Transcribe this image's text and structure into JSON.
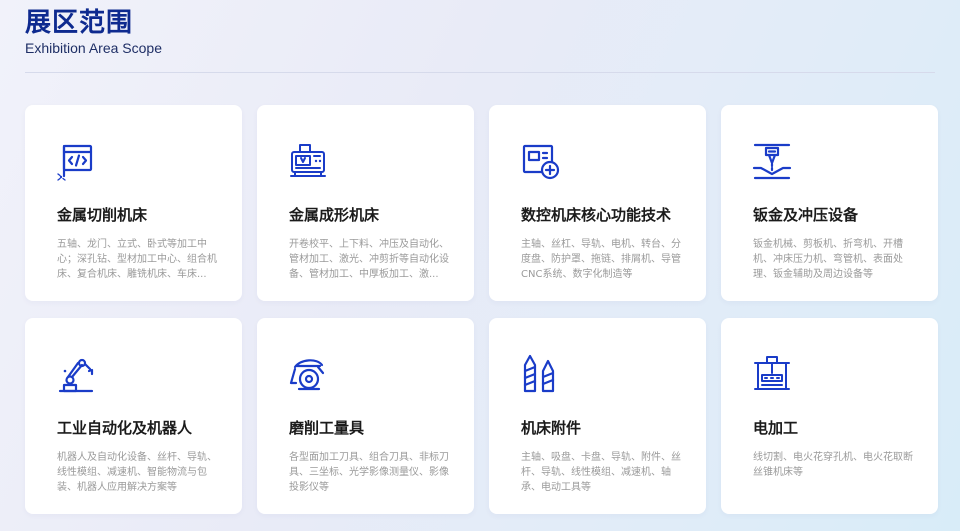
{
  "header": {
    "title": "展区范围",
    "subtitle": "Exhibition Area Scope"
  },
  "accent_color": "#1a3cc8",
  "cards": [
    {
      "icon": "code-window-icon",
      "title": "金属切削机床",
      "desc": "五轴、龙门、立式、卧式等加工中心；深孔钻、型材加工中心、组合机床、复合机床、雕铣机床、车床..."
    },
    {
      "icon": "cnc-machine-icon",
      "title": "金属成形机床",
      "desc": "开卷校平、上下料、冲压及自动化、管材加工、激光、冲剪折等自动化设备、管材加工、中厚板加工、激..."
    },
    {
      "icon": "control-panel-icon",
      "title": "数控机床核心功能技术",
      "desc": "主轴、丝杠、导轨、电机、转台、分度盘、防护罩、拖链、排屑机、导管CNC系统、数字化制造等"
    },
    {
      "icon": "press-icon",
      "title": "钣金及冲压设备",
      "desc": "钣金机械、剪板机、折弯机、开槽机、冲床压力机、弯管机、表面处理、钣金辅助及周边设备等"
    },
    {
      "icon": "robot-arm-icon",
      "title": "工业自动化及机器人",
      "desc": "机器人及自动化设备、丝杆、导轨、线性模组、减速机、智能物流与包装、机器人应用解决方案等"
    },
    {
      "icon": "grinder-icon",
      "title": "磨削工量具",
      "desc": "各型面加工刀具、组合刀具、非标刀具、三坐标、光学影像测量仪、影像投影仪等"
    },
    {
      "icon": "drill-bit-icon",
      "title": "机床附件",
      "desc": "主轴、吸盘、卡盘、导轨、附件、丝杆、导轨、线性模组、减速机、轴承、电动工具等"
    },
    {
      "icon": "edm-machine-icon",
      "title": "电加工",
      "desc": "线切割、电火花穿孔机、电火花取断丝锥机床等"
    }
  ]
}
